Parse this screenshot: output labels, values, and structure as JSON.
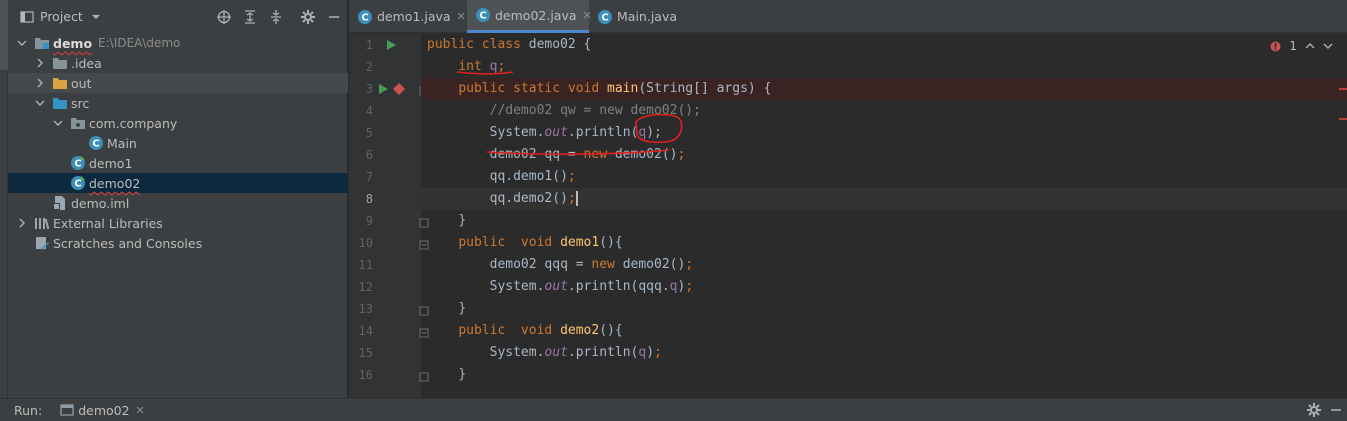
{
  "project_panel": {
    "title": "Project",
    "tree": [
      {
        "label": "demo",
        "path": "E:\\IDEA\\demo"
      },
      {
        "label": ".idea"
      },
      {
        "label": "out"
      },
      {
        "label": "src"
      },
      {
        "label": "com.company"
      },
      {
        "label": "Main"
      },
      {
        "label": "demo1"
      },
      {
        "label": "demo02"
      },
      {
        "label": "demo.iml"
      },
      {
        "label": "External Libraries"
      },
      {
        "label": "Scratches and Consoles"
      }
    ]
  },
  "tabs": [
    {
      "label": "demo1.java"
    },
    {
      "label": "demo02.java"
    },
    {
      "label": "Main.java"
    }
  ],
  "inspection": {
    "count": "1"
  },
  "code": {
    "line_numbers": [
      "1",
      "2",
      "3",
      "4",
      "5",
      "6",
      "7",
      "8",
      "9",
      "10",
      "11",
      "12",
      "13",
      "14",
      "15",
      "16"
    ],
    "l1": {
      "a": "public class ",
      "b": "demo02 {"
    },
    "l2": {
      "a": "int ",
      "b": "q",
      "c": ";"
    },
    "l3": {
      "a": "public static void ",
      "b": "main",
      "c": "(String[] args) {"
    },
    "l4": {
      "a": "//demo02 qw = new demo02();"
    },
    "l5": {
      "a": "System.",
      "b": "out",
      "c": ".println(",
      "d": "q",
      "e": ");"
    },
    "l6": {
      "a": "demo02 qq = ",
      "b": "new ",
      "c": "demo02()",
      "d": ";"
    },
    "l7": {
      "a": "qq.demo1()",
      "b": ";"
    },
    "l8": {
      "a": "qq.demo2()",
      "b": ";"
    },
    "l9": {
      "a": "}"
    },
    "l10": {
      "a": "public  void ",
      "b": "demo1",
      "c": "(){"
    },
    "l11": {
      "a": "demo02 qqq = ",
      "b": "new ",
      "c": "demo02()",
      "d": ";"
    },
    "l12": {
      "a": "System.",
      "b": "out",
      "c": ".println(qqq.",
      "d": "q",
      "e": ")",
      "f": ";"
    },
    "l13": {
      "a": "}"
    },
    "l14": {
      "a": "public  void ",
      "b": "demo2",
      "c": "(){"
    },
    "l15": {
      "a": "System.",
      "b": "out",
      "c": ".println(",
      "d": "q",
      "e": ")",
      "f": ";"
    },
    "l16": {
      "a": "}"
    }
  },
  "run_bar": {
    "label": "Run:",
    "tab_label": "demo02"
  }
}
